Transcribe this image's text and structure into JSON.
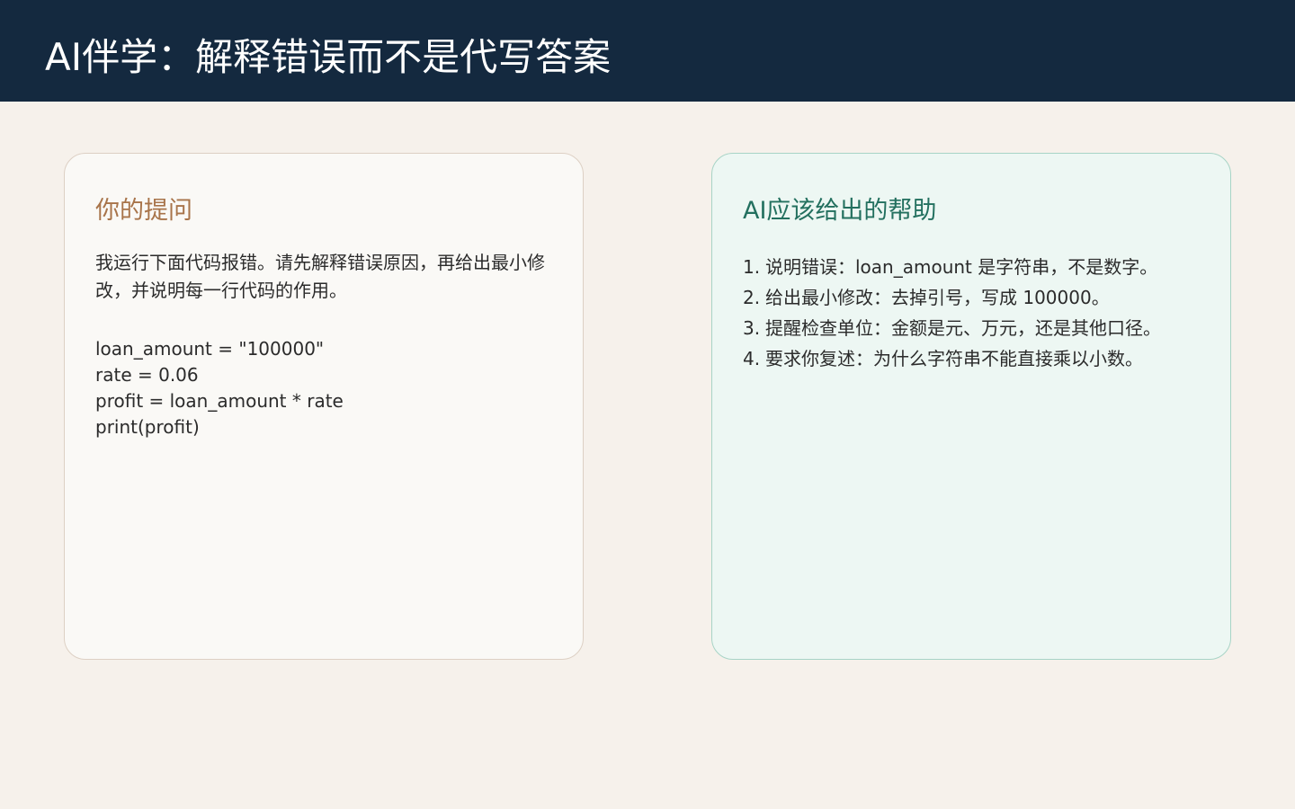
{
  "header": {
    "title": "AI伴学：解释错误而不是代写答案"
  },
  "question_card": {
    "title": "你的提问",
    "prompt": "我运行下面代码报错。请先解释错误原因，再给出最小修改，并说明每一行代码的作用。",
    "code_lines": [
      "loan_amount = \"100000\"",
      "rate = 0.06",
      "profit = loan_amount * rate",
      "print(profit)"
    ]
  },
  "help_card": {
    "title": "AI应该给出的帮助",
    "items": [
      {
        "num": "1.",
        "text": "说明错误：loan_amount 是字符串，不是数字。"
      },
      {
        "num": "2.",
        "text": "给出最小修改：去掉引号，写成 100000。"
      },
      {
        "num": "3.",
        "text": "提醒检查单位：金额是元、万元，还是其他口径。"
      },
      {
        "num": "4.",
        "text": "要求你复述：为什么字符串不能直接乘以小数。"
      }
    ]
  },
  "colors": {
    "header_bg": "#14293f",
    "page_bg": "#f6f1eb",
    "question_accent": "#a8744a",
    "help_accent": "#23705f"
  }
}
